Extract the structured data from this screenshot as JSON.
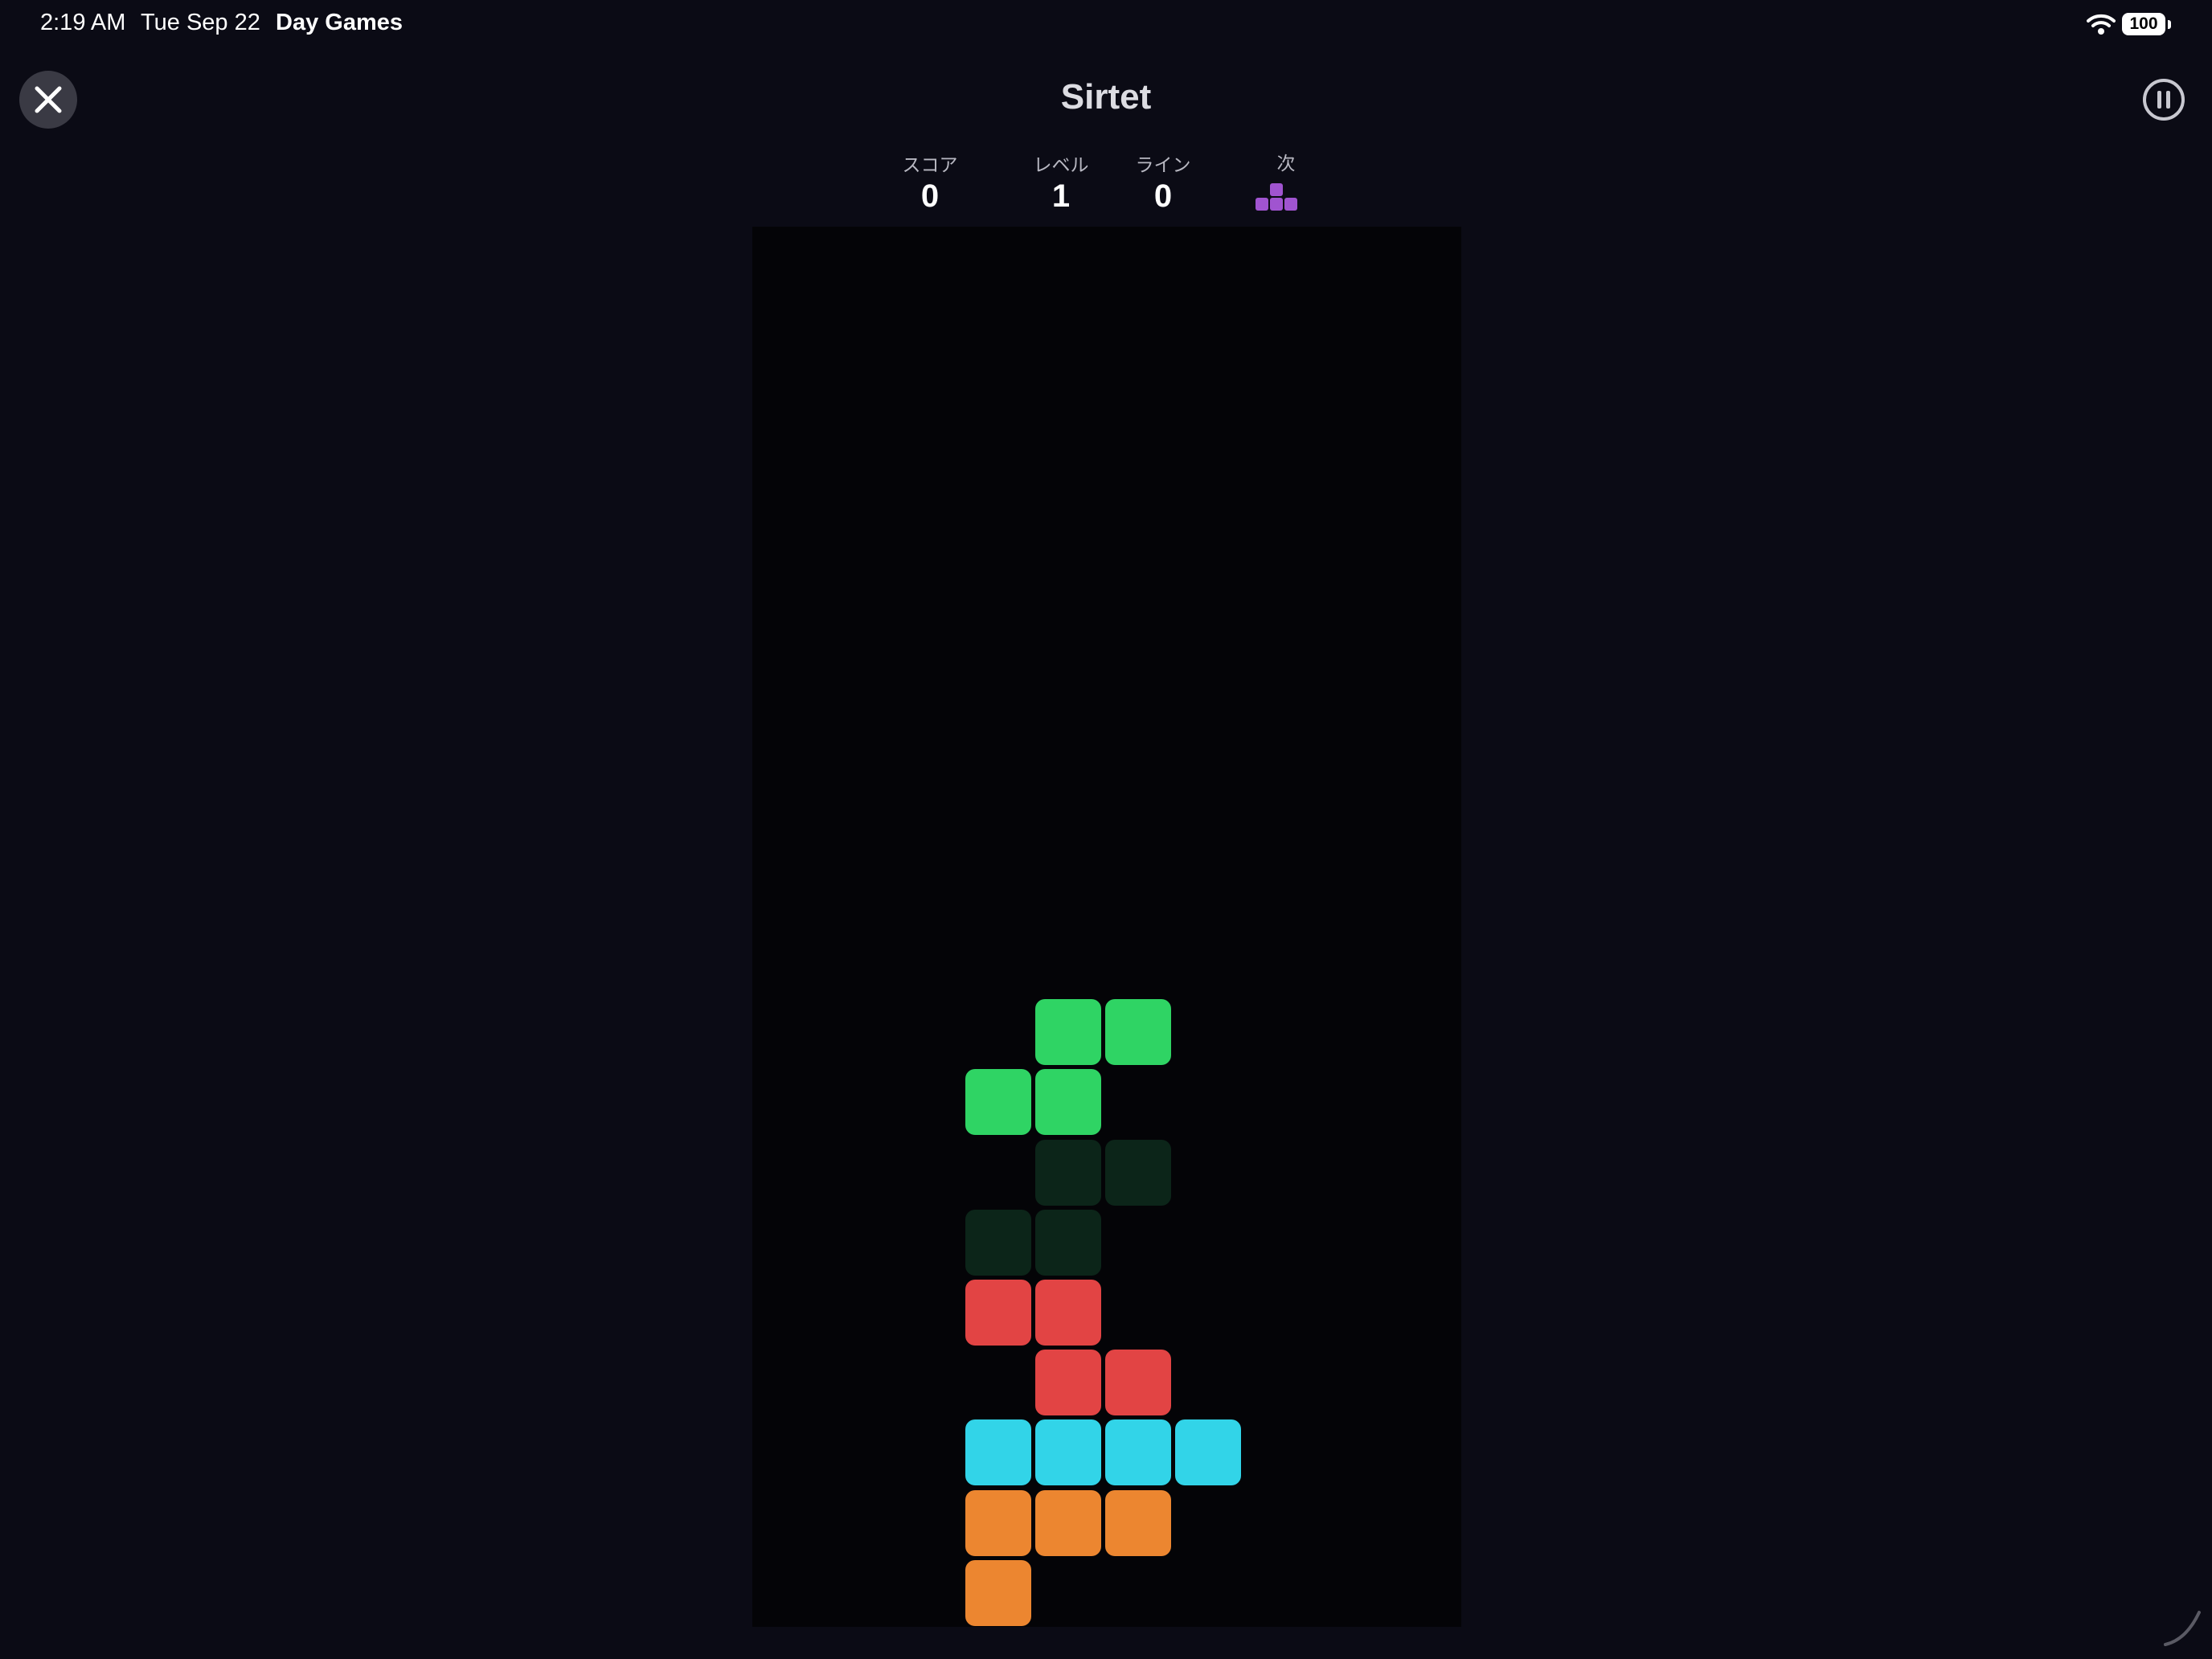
{
  "status_bar": {
    "time": "2:19 AM",
    "date": "Tue Sep 22",
    "app_name": "Day Games",
    "battery": "100",
    "wifi_icon": "wifi-icon",
    "battery_icon": "battery-icon"
  },
  "header": {
    "title": "Sirtet",
    "close_icon": "close-icon",
    "pause_icon": "pause-icon"
  },
  "stats": {
    "score_label": "スコア",
    "score_value": "0",
    "level_label": "レベル",
    "level_value": "1",
    "lines_label": "ライン",
    "lines_value": "0",
    "next_label": "次"
  },
  "next_piece": {
    "shape": "T",
    "color": "#a054d0"
  },
  "board": {
    "columns": 10,
    "rows": 20,
    "background": "#040407",
    "active_piece": {
      "shape": "S",
      "color": "#2fd464",
      "cells": [
        [
          4,
          11
        ],
        [
          5,
          11
        ],
        [
          3,
          12
        ],
        [
          4,
          12
        ]
      ]
    },
    "ghost_piece": {
      "shape": "S",
      "color": "#0c2519",
      "cells": [
        [
          4,
          13
        ],
        [
          5,
          13
        ],
        [
          3,
          14
        ],
        [
          4,
          14
        ]
      ]
    },
    "locked_cells": [
      {
        "col": 3,
        "row": 15,
        "color": "#e24444"
      },
      {
        "col": 4,
        "row": 15,
        "color": "#e24444"
      },
      {
        "col": 4,
        "row": 16,
        "color": "#e24444"
      },
      {
        "col": 5,
        "row": 16,
        "color": "#e24444"
      },
      {
        "col": 3,
        "row": 17,
        "color": "#32d4e8"
      },
      {
        "col": 4,
        "row": 17,
        "color": "#32d4e8"
      },
      {
        "col": 5,
        "row": 17,
        "color": "#32d4e8"
      },
      {
        "col": 6,
        "row": 17,
        "color": "#32d4e8"
      },
      {
        "col": 3,
        "row": 18,
        "color": "#ec8630"
      },
      {
        "col": 4,
        "row": 18,
        "color": "#ec8630"
      },
      {
        "col": 5,
        "row": 18,
        "color": "#ec8630"
      },
      {
        "col": 3,
        "row": 19,
        "color": "#ec8630"
      }
    ]
  }
}
